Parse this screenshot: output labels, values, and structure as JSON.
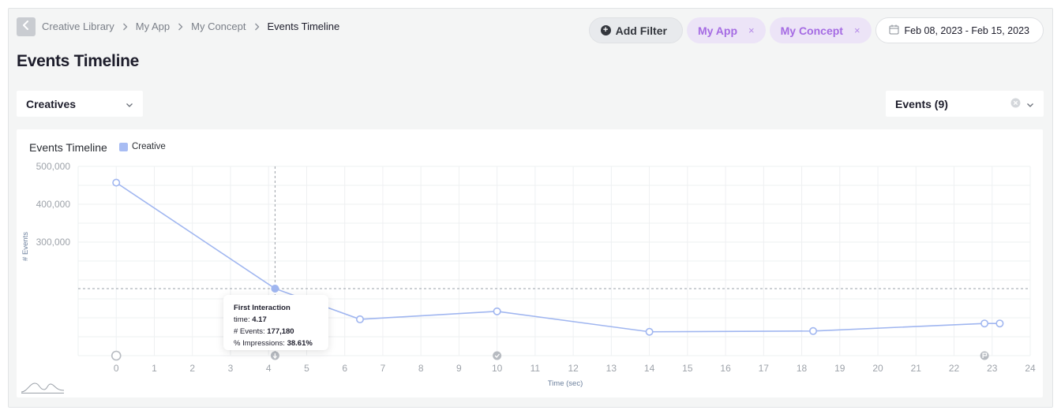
{
  "breadcrumb": {
    "items": [
      "Creative Library",
      "My App",
      "My Concept"
    ],
    "current": "Events Timeline"
  },
  "page": {
    "title": "Events Timeline"
  },
  "filters": {
    "add_label": "Add Filter",
    "tags": [
      {
        "label": "My App",
        "remove": "×"
      },
      {
        "label": "My Concept",
        "remove": "×"
      }
    ],
    "date_range": "Feb 08, 2023 - Feb 15, 2023"
  },
  "selects": {
    "creatives": "Creatives",
    "events": "Events (9)"
  },
  "colors": {
    "accent": "#a56be3",
    "series": "#a8bcf3",
    "line": "#a0b6f0"
  },
  "chart_data": {
    "type": "line",
    "title": "Events Timeline",
    "xlabel": "Time (sec)",
    "ylabel": "# Events",
    "xlim": [
      -1,
      24
    ],
    "ylim": [
      0,
      500000
    ],
    "x_ticks": [
      0,
      1,
      2,
      3,
      4,
      5,
      6,
      7,
      8,
      9,
      10,
      11,
      12,
      13,
      14,
      15,
      16,
      17,
      18,
      19,
      20,
      21,
      22,
      23,
      24
    ],
    "y_ticks": [
      300000,
      400000,
      500000
    ],
    "y_tick_labels": [
      "300,000",
      "400,000",
      "500,000"
    ],
    "grid": true,
    "legend": "top-left",
    "series": [
      {
        "name": "Creative",
        "x": [
          0,
          4.17,
          6.4,
          10,
          14,
          18.3,
          22.8,
          23.2
        ],
        "y": [
          457000,
          177180,
          96000,
          117000,
          63000,
          65000,
          85000,
          85000
        ]
      }
    ],
    "markers": [
      {
        "x": 0,
        "icon": "start-icon"
      },
      {
        "x": 4.17,
        "icon": "interaction-icon"
      },
      {
        "x": 10,
        "icon": "check-icon"
      },
      {
        "x": 22.8,
        "icon": "end-flag-icon"
      }
    ],
    "tooltip": {
      "title": "First Interaction",
      "rows": [
        {
          "label": "time: ",
          "value": "4.17"
        },
        {
          "label": "# Events: ",
          "value": "177,180"
        },
        {
          "label": "% Impressions: ",
          "value": "38.61%"
        }
      ]
    }
  }
}
